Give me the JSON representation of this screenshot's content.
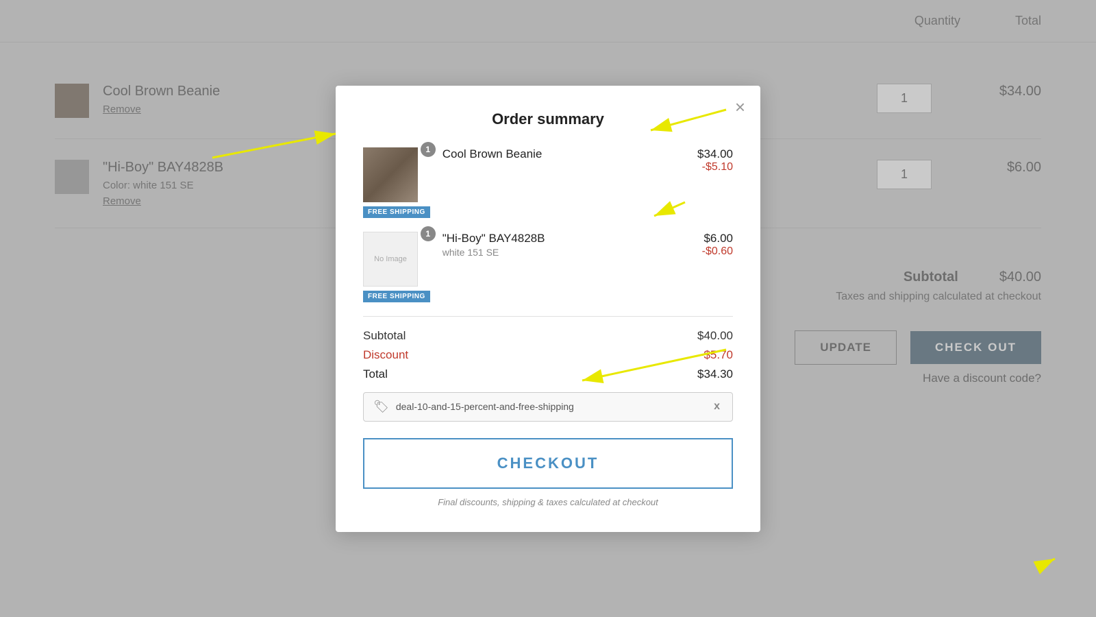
{
  "page": {
    "background_color": "#d0d0d0"
  },
  "bg_table": {
    "headers": [
      "Quantity",
      "Total"
    ],
    "items": [
      {
        "name": "Cool Brown Beanie",
        "remove_label": "Remove",
        "qty": "1",
        "price": "$34.00"
      },
      {
        "name": "\"Hi-Boy\" BAY4828B",
        "color": "Color: white 151 SE",
        "remove_label": "Remove",
        "qty": "1",
        "price": "$6.00"
      }
    ],
    "subtotal_label": "Subtotal",
    "subtotal_value": "$40.00",
    "tax_note": "Taxes and shipping calculated at checkout",
    "update_label": "UPDATE",
    "checkout_label": "CHECK OUT",
    "discount_link": "Have a discount code?"
  },
  "modal": {
    "title": "Order summary",
    "close_label": "×",
    "items": [
      {
        "name": "Cool Brown Beanie",
        "count": "1",
        "free_shipping": "FREE SHIPPING",
        "price": "$34.00",
        "discount": "-$5.10"
      },
      {
        "name": "\"Hi-Boy\" BAY4828B",
        "variant": "white 151 SE",
        "count": "1",
        "free_shipping": "FREE SHIPPING",
        "price": "$6.00",
        "discount": "-$0.60"
      }
    ],
    "subtotal_label": "Subtotal",
    "subtotal_value": "$40.00",
    "discount_label": "Discount",
    "discount_value": "-$5.70",
    "total_label": "Total",
    "total_value": "$34.30",
    "coupon_code": "deal-10-and-15-percent-and-free-shipping",
    "coupon_remove": "x",
    "checkout_label": "CHECKOUT",
    "checkout_note": "Final discounts, shipping & taxes calculated at checkout"
  }
}
